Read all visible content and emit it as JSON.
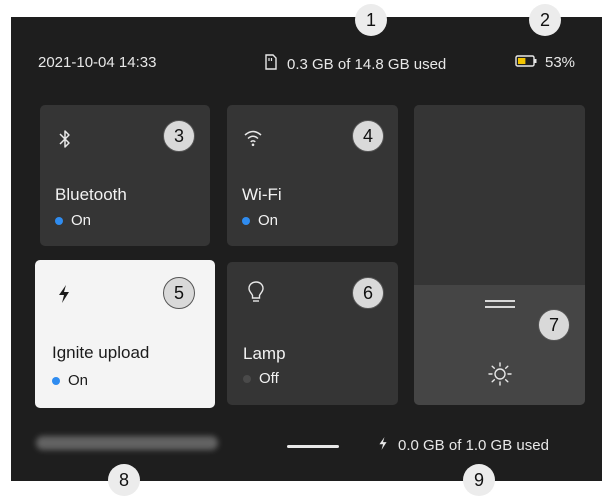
{
  "status_bar": {
    "datetime": "2021-10-04  14:33",
    "storage_used": "0.3 GB of 14.8 GB used",
    "battery_percent": "53%",
    "battery_level": 0.53
  },
  "tiles": {
    "bluetooth": {
      "title": "Bluetooth",
      "status": "On",
      "icon": "bluetooth-icon"
    },
    "wifi": {
      "title": "Wi-Fi",
      "status": "On",
      "icon": "wifi-icon"
    },
    "ignite_upload": {
      "title": "Ignite upload",
      "status": "On",
      "icon": "lightning-icon"
    },
    "lamp": {
      "title": "Lamp",
      "status": "Off",
      "icon": "lightbulb-icon"
    },
    "brightness": {
      "icon": "sun-icon"
    }
  },
  "footer": {
    "email": "",
    "upload_used": "0.0 GB of 1.0 GB used"
  },
  "callouts": [
    "1",
    "2",
    "3",
    "4",
    "5",
    "6",
    "7",
    "8",
    "9"
  ],
  "colors": {
    "background": "#1e1e1e",
    "tile": "#353535",
    "tile_active": "#f4f4f4",
    "status_on": "#2f8cf0",
    "status_off": "#4a4a4a",
    "battery_fill": "#f2c400"
  }
}
